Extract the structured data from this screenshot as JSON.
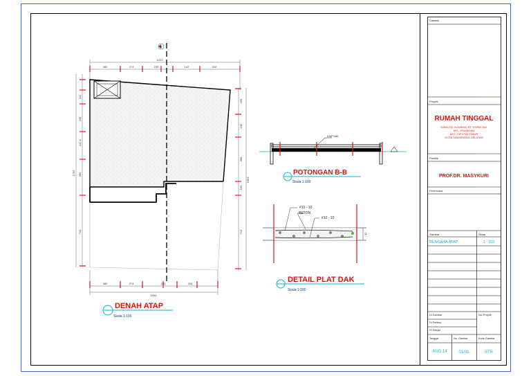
{
  "plan": {
    "title": "DENAH ATAP",
    "scale": "Skala 1:100",
    "top_dims": [
      "380",
      "274",
      "235",
      "142",
      "330"
    ],
    "top_total": "1201",
    "bottom_dims": [
      "380",
      "274",
      "253",
      "254"
    ],
    "bottom_total": "1064",
    "left_dims": [
      "112",
      "106",
      "217.5",
      "380",
      "720"
    ],
    "left_total": "1763",
    "right_dims": [
      "209",
      "242",
      "389",
      "150",
      "713"
    ],
    "right_total": "1693",
    "section_marker": "B"
  },
  "section": {
    "title": "POTONGAN B-B",
    "scale": "Skala 1:100",
    "label": "ATAP DAK"
  },
  "detail": {
    "title": "DETAIL PLAT DAK",
    "scale": "Skala 1:100",
    "rebar_top": "#10 - 10",
    "concrete": "BETON",
    "rebar_bottom": "#10 - 10",
    "thickness": "12"
  },
  "titleblock": {
    "catatan_label": "Catatan",
    "proyek_label": "Proyek",
    "project_name": "RUMAH TINGGAL",
    "address": [
      "GANG HJ. KOWENG RT. 07/RW. 001",
      "KEL. PISANGAN",
      "KEC. CIPUTAT TIMUR",
      "KOTA TANGERANG SELATAN"
    ],
    "pemilik_label": "Pemilik",
    "owner": "PROF.DR. MASYKURI",
    "perencana_label": "Perencana",
    "gambar_label": "Gambar",
    "skala_label": "Skala",
    "drawing_name": "RENCANA ATAP",
    "drawing_scale": "1 : 100",
    "digambar_label": "Di Gambar",
    "diperiksa_label": "Di Periksa",
    "disetujui_label": "Di Setujui",
    "no_proyek_label": "No. Proyek",
    "tanggal_label": "Tanggal",
    "no_gambar_label": "No. Gambar",
    "kode_gambar_label": "Kode Gambar",
    "date": "AUG 14",
    "sheet_no": "01/01",
    "code": "STR"
  },
  "colors": {
    "red": "#e01010",
    "cyan": "#00b8d8",
    "green": "#6aa84f",
    "frame_blue": "#3a6ec8"
  }
}
